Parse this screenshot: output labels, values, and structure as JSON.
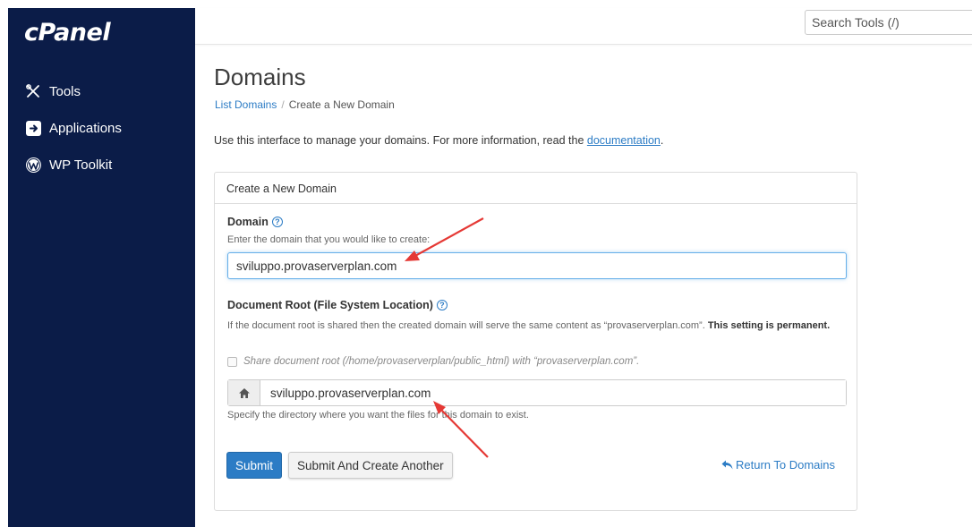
{
  "app": {
    "logo": "cPanel"
  },
  "sidebar": {
    "items": [
      {
        "label": "Tools",
        "icon": "tools-icon"
      },
      {
        "label": "Applications",
        "icon": "applications-icon"
      },
      {
        "label": "WP Toolkit",
        "icon": "wordpress-icon"
      }
    ]
  },
  "header": {
    "search_placeholder": "Search Tools (/)"
  },
  "page": {
    "title": "Domains",
    "breadcrumb": {
      "parent": "List Domains",
      "separator": "/",
      "current": "Create a New Domain"
    },
    "intro_text": "Use this interface to manage your domains. For more information, read the ",
    "intro_link": "documentation",
    "intro_end": "."
  },
  "form": {
    "panel_title": "Create a New Domain",
    "domain_label": "Domain",
    "domain_help": "Enter the domain that you would like to create:",
    "domain_value": "sviluppo.provaserverplan.com",
    "docroot_label": "Document Root (File System Location)",
    "docroot_help_text": "If the document root is shared then the created domain will serve the same content as “provaserverplan.com”. ",
    "docroot_help_bold": "This setting is permanent.",
    "share_checkbox_label": "Share document root (/home/provaserverplan/public_html) with “provaserverplan.com”.",
    "share_checked": false,
    "docroot_value": "sviluppo.provaserverplan.com",
    "docroot_addon_icon": "home-icon",
    "docroot_hint": "Specify the directory where you want the files for this domain to exist.",
    "submit_label": "Submit",
    "submit_another_label": "Submit And Create Another",
    "return_label": "Return To Domains",
    "help_glyph": "?"
  },
  "colors": {
    "sidebar_bg": "#0b1c48",
    "primary": "#2c7cc5",
    "annotation_arrow": "#e53935"
  }
}
